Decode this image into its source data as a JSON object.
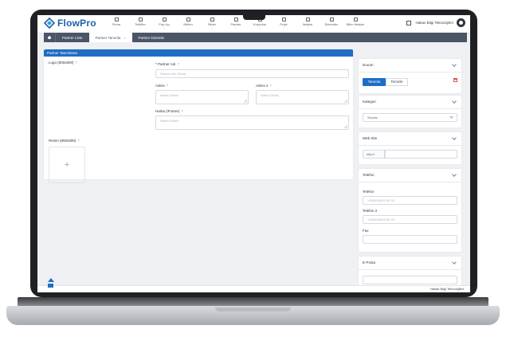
{
  "app": {
    "logo_text": "FlowPro",
    "user_name": "Hakan Bilgi Teknolojileri"
  },
  "nav": [
    {
      "label": "Firma",
      "icon": "building-icon"
    },
    {
      "label": "Teklifler",
      "icon": "document-icon"
    },
    {
      "label": "Pop-Up",
      "icon": "popup-icon"
    },
    {
      "label": "Bülten",
      "icon": "newsletter-icon"
    },
    {
      "label": "Slider",
      "icon": "slider-icon"
    },
    {
      "label": "Partner",
      "icon": "partner-icon"
    },
    {
      "label": "Kuponlar",
      "icon": "coupon-icon"
    },
    {
      "label": "Proje",
      "icon": "project-icon"
    },
    {
      "label": "İletişim",
      "icon": "contact-icon"
    },
    {
      "label": "Eklentiler",
      "icon": "plugin-icon"
    },
    {
      "label": "Bilim İletişim",
      "icon": "user-icon"
    }
  ],
  "tabs": {
    "home_icon": "home-icon",
    "list": "Partner Liste",
    "define": "Partner Tanımla",
    "close": "×",
    "edit": "Partner Düzenle"
  },
  "form": {
    "title": "Partner Tanımlama",
    "logo_label": "Logo (800x800)",
    "name_label": "* Partner Adı",
    "name_placeholder": "Partner Adı Giriniz",
    "address_label": "Adres",
    "address_placeholder": "Adres Giriniz",
    "address2_label": "Adres 2",
    "address2_placeholder": "Adres Giriniz",
    "map_label": "Harita (iFrame)",
    "map_placeholder": "Harita Giriniz",
    "image_label": "Resim (800x800)",
    "help_mark": "?",
    "plus": "+"
  },
  "side": {
    "status": {
      "title": "Durum",
      "primary": "Tanımla",
      "secondary": "Temizle"
    },
    "category": {
      "title": "Kategori",
      "value": "Seçiniz"
    },
    "website": {
      "title": "Web Site",
      "prefix": "http://"
    },
    "phone": {
      "title": "Telefon",
      "phone_label": "Telefon",
      "phone_placeholder": "+90(000)000 00 00",
      "phone2_label": "Telefon 2",
      "phone2_placeholder": "+90(000)000 00 00",
      "fax_label": "Fax"
    },
    "email": {
      "title": "E-Posta"
    }
  },
  "footer": {
    "text": "Hakan Bilgi Teknolojileri"
  },
  "colors": {
    "primary": "#1e6ec3",
    "tabbar": "#4a5568",
    "danger": "#d9534f"
  }
}
